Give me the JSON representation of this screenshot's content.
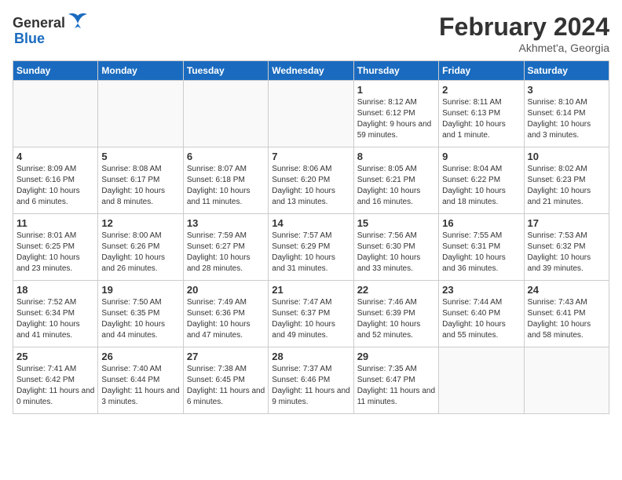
{
  "header": {
    "logo_general": "General",
    "logo_blue": "Blue",
    "month_year": "February 2024",
    "location": "Akhmet'a, Georgia"
  },
  "days_of_week": [
    "Sunday",
    "Monday",
    "Tuesday",
    "Wednesday",
    "Thursday",
    "Friday",
    "Saturday"
  ],
  "weeks": [
    [
      {
        "day": "",
        "info": ""
      },
      {
        "day": "",
        "info": ""
      },
      {
        "day": "",
        "info": ""
      },
      {
        "day": "",
        "info": ""
      },
      {
        "day": "1",
        "sunrise": "8:12 AM",
        "sunset": "6:12 PM",
        "daylight": "9 hours and 59 minutes."
      },
      {
        "day": "2",
        "sunrise": "8:11 AM",
        "sunset": "6:13 PM",
        "daylight": "10 hours and 1 minute."
      },
      {
        "day": "3",
        "sunrise": "8:10 AM",
        "sunset": "6:14 PM",
        "daylight": "10 hours and 3 minutes."
      }
    ],
    [
      {
        "day": "4",
        "sunrise": "8:09 AM",
        "sunset": "6:16 PM",
        "daylight": "10 hours and 6 minutes."
      },
      {
        "day": "5",
        "sunrise": "8:08 AM",
        "sunset": "6:17 PM",
        "daylight": "10 hours and 8 minutes."
      },
      {
        "day": "6",
        "sunrise": "8:07 AM",
        "sunset": "6:18 PM",
        "daylight": "10 hours and 11 minutes."
      },
      {
        "day": "7",
        "sunrise": "8:06 AM",
        "sunset": "6:20 PM",
        "daylight": "10 hours and 13 minutes."
      },
      {
        "day": "8",
        "sunrise": "8:05 AM",
        "sunset": "6:21 PM",
        "daylight": "10 hours and 16 minutes."
      },
      {
        "day": "9",
        "sunrise": "8:04 AM",
        "sunset": "6:22 PM",
        "daylight": "10 hours and 18 minutes."
      },
      {
        "day": "10",
        "sunrise": "8:02 AM",
        "sunset": "6:23 PM",
        "daylight": "10 hours and 21 minutes."
      }
    ],
    [
      {
        "day": "11",
        "sunrise": "8:01 AM",
        "sunset": "6:25 PM",
        "daylight": "10 hours and 23 minutes."
      },
      {
        "day": "12",
        "sunrise": "8:00 AM",
        "sunset": "6:26 PM",
        "daylight": "10 hours and 26 minutes."
      },
      {
        "day": "13",
        "sunrise": "7:59 AM",
        "sunset": "6:27 PM",
        "daylight": "10 hours and 28 minutes."
      },
      {
        "day": "14",
        "sunrise": "7:57 AM",
        "sunset": "6:29 PM",
        "daylight": "10 hours and 31 minutes."
      },
      {
        "day": "15",
        "sunrise": "7:56 AM",
        "sunset": "6:30 PM",
        "daylight": "10 hours and 33 minutes."
      },
      {
        "day": "16",
        "sunrise": "7:55 AM",
        "sunset": "6:31 PM",
        "daylight": "10 hours and 36 minutes."
      },
      {
        "day": "17",
        "sunrise": "7:53 AM",
        "sunset": "6:32 PM",
        "daylight": "10 hours and 39 minutes."
      }
    ],
    [
      {
        "day": "18",
        "sunrise": "7:52 AM",
        "sunset": "6:34 PM",
        "daylight": "10 hours and 41 minutes."
      },
      {
        "day": "19",
        "sunrise": "7:50 AM",
        "sunset": "6:35 PM",
        "daylight": "10 hours and 44 minutes."
      },
      {
        "day": "20",
        "sunrise": "7:49 AM",
        "sunset": "6:36 PM",
        "daylight": "10 hours and 47 minutes."
      },
      {
        "day": "21",
        "sunrise": "7:47 AM",
        "sunset": "6:37 PM",
        "daylight": "10 hours and 49 minutes."
      },
      {
        "day": "22",
        "sunrise": "7:46 AM",
        "sunset": "6:39 PM",
        "daylight": "10 hours and 52 minutes."
      },
      {
        "day": "23",
        "sunrise": "7:44 AM",
        "sunset": "6:40 PM",
        "daylight": "10 hours and 55 minutes."
      },
      {
        "day": "24",
        "sunrise": "7:43 AM",
        "sunset": "6:41 PM",
        "daylight": "10 hours and 58 minutes."
      }
    ],
    [
      {
        "day": "25",
        "sunrise": "7:41 AM",
        "sunset": "6:42 PM",
        "daylight": "11 hours and 0 minutes."
      },
      {
        "day": "26",
        "sunrise": "7:40 AM",
        "sunset": "6:44 PM",
        "daylight": "11 hours and 3 minutes."
      },
      {
        "day": "27",
        "sunrise": "7:38 AM",
        "sunset": "6:45 PM",
        "daylight": "11 hours and 6 minutes."
      },
      {
        "day": "28",
        "sunrise": "7:37 AM",
        "sunset": "6:46 PM",
        "daylight": "11 hours and 9 minutes."
      },
      {
        "day": "29",
        "sunrise": "7:35 AM",
        "sunset": "6:47 PM",
        "daylight": "11 hours and 11 minutes."
      },
      {
        "day": "",
        "info": ""
      },
      {
        "day": "",
        "info": ""
      }
    ]
  ]
}
